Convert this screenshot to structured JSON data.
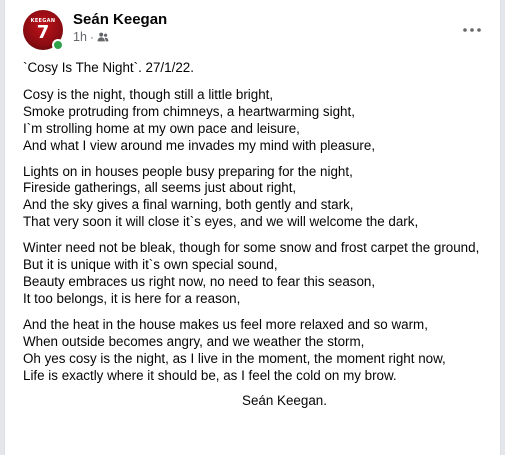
{
  "post": {
    "author": "Seán Keegan",
    "timestamp": "1h",
    "separator": "·",
    "audience_icon": "friends-icon",
    "more_icon": "more-horizontal-icon",
    "avatar": {
      "shirt_name": "KEEGAN",
      "shirt_number": "7",
      "online_color": "#31a24c"
    },
    "title": "`Cosy Is The Night`. 27/1/22.",
    "stanzas": [
      [
        "Cosy is the night, though still a little bright,",
        "Smoke protruding from chimneys, a heartwarming sight,",
        "I`m strolling home at my own pace and leisure,",
        "And what I view around me invades my mind with pleasure,"
      ],
      [
        "Lights on in houses people busy preparing for the night,",
        "Fireside gatherings, all seems just about right,",
        "And the sky gives a final warning, both gently and stark,",
        "That very soon it will close it`s eyes, and we will welcome the dark,"
      ],
      [
        "Winter need not be bleak, though for some snow and frost carpet the ground,",
        "But it is unique with it`s own special sound,",
        "Beauty embraces us right now, no need to fear this season,",
        "It too belongs, it is here for a reason,"
      ],
      [
        "And the heat in the house makes us feel more relaxed and so warm,",
        "When outside becomes angry, and we weather the storm,",
        "Oh yes cosy is the night, as I live in the moment, the moment right now,",
        "Life is exactly where it should be, as I feel the cold on my brow."
      ]
    ],
    "signature": "Seán Keegan."
  }
}
